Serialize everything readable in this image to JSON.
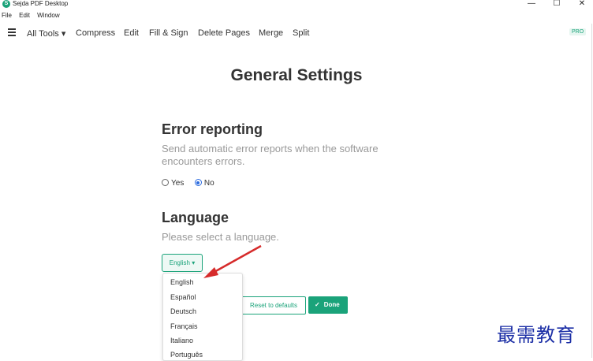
{
  "window": {
    "title": "Sejda PDF Desktop",
    "logo_letter": "S",
    "minimize_glyph": "—",
    "maximize_glyph": "☐",
    "close_glyph": "✕"
  },
  "menubar": [
    "File",
    "Edit",
    "Window"
  ],
  "toolbar": {
    "all_tools": "All Tools ▾",
    "compress": "Compress",
    "edit": "Edit",
    "fill_sign": "Fill & Sign",
    "delete_pages": "Delete Pages",
    "merge": "Merge",
    "split": "Split",
    "pro_badge": "PRO"
  },
  "page": {
    "title": "General Settings"
  },
  "error_reporting": {
    "heading": "Error reporting",
    "description": "Send automatic error reports when the software encounters errors.",
    "options": [
      {
        "label": "Yes",
        "checked": false
      },
      {
        "label": "No",
        "checked": true
      }
    ]
  },
  "language": {
    "heading": "Language",
    "description": "Please select a language.",
    "selected": "English ▾",
    "options": [
      "English",
      "Español",
      "Deutsch",
      "Français",
      "Italiano",
      "Português"
    ]
  },
  "actions": {
    "reset_label": "Reset to defaults",
    "done_label": "Done",
    "done_icon": "✓"
  },
  "watermark": "最需教育",
  "colors": {
    "accent": "#1aa37a",
    "annotation_arrow": "#d62b2b",
    "watermark": "#1c2fa6"
  }
}
